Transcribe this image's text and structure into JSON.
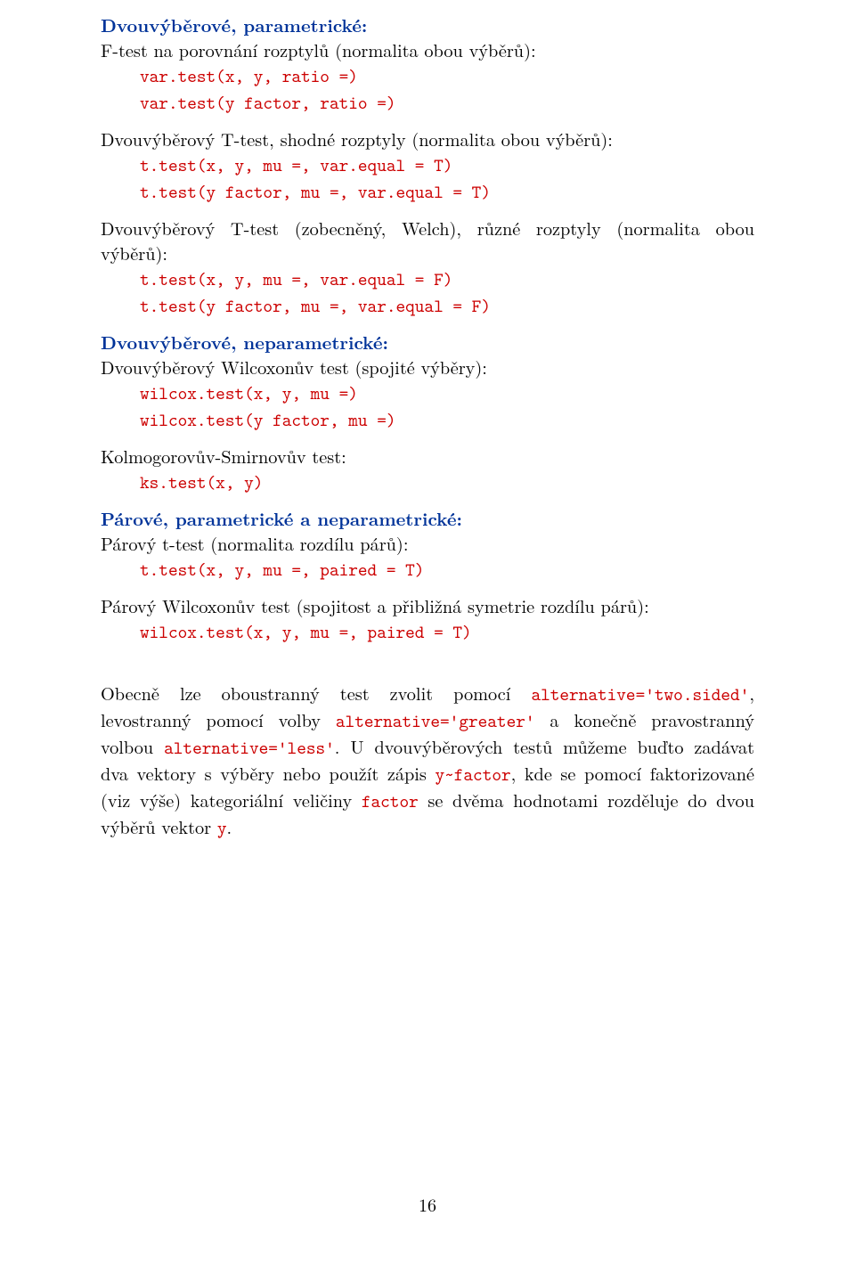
{
  "s1": {
    "heading": "Dvouvýběrové, parametrické:",
    "intro": "F-test na porovnání rozptylů (normalita obou výběrů):",
    "code1": "var.test(x, y, ratio =)",
    "code2": "var.test(y factor, ratio =)"
  },
  "s2": {
    "intro": "Dvouvýběrový T-test, shodné rozptyly (normalita obou výběrů):",
    "code1": "t.test(x, y, mu =, var.equal = T)",
    "code2": "t.test(y factor, mu =, var.equal = T)"
  },
  "s3": {
    "intro": "Dvouvýběrový T-test (zobecněný, Welch), různé rozptyly (normalita obou výběrů):",
    "code1": "t.test(x, y, mu =, var.equal = F)",
    "code2": "t.test(y factor, mu =, var.equal = F)"
  },
  "s4": {
    "heading": "Dvouvýběrové, neparametrické:",
    "intro": "Dvouvýběrový Wilcoxonův test (spojité výběry):",
    "code1": "wilcox.test(x, y, mu =)",
    "code2": "wilcox.test(y factor, mu =)"
  },
  "s5": {
    "intro": "Kolmogorovův-Smirnovův test:",
    "code1": "ks.test(x, y)"
  },
  "s6": {
    "heading": "Párové, parametrické a neparametrické:",
    "intro": "Párový t-test (normalita rozdílu párů):",
    "code1": "t.test(x, y, mu =, paired = T)"
  },
  "s7": {
    "intro": "Párový Wilcoxonův test (spojitost a přibližná symetrie rozdílu párů):",
    "code1": "wilcox.test(x, y, mu =, paired = T)"
  },
  "para": {
    "t1": "Obecně lze oboustranný test zvolit pomocí ",
    "c1": "alternative='two.sided'",
    "t2": ", levostranný pomocí volby ",
    "c2": "alternative='greater'",
    "t3": " a konečně pravostranný volbou ",
    "c3": "alternative='less'",
    "t4": ". U dvouvýběrových testů můžeme buďto zadávat dva vektory s výběry nebo použít zápis ",
    "c4": "y~factor",
    "t5": ", kde se pomocí faktorizované (viz výše) kategoriální veličiny ",
    "c5": "factor",
    "t6": " se dvěma hodnotami rozděluje do dvou výběrů vektor ",
    "c6": "y",
    "t7": "."
  },
  "page_number": "16"
}
